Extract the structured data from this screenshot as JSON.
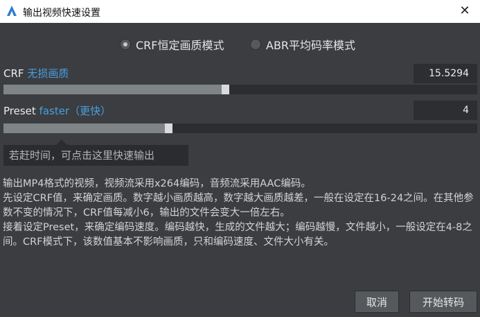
{
  "window": {
    "title": "输出视频快速设置",
    "close_glyph": "✕"
  },
  "modes": [
    {
      "label": "CRF恒定画质模式",
      "checked": true
    },
    {
      "label": "ABR平均码率模式",
      "checked": false
    }
  ],
  "crf": {
    "label": "CRF",
    "quality_text": "无损画质",
    "value": "15.5294",
    "level": 0.46
  },
  "preset": {
    "label": "Preset",
    "speed_text": "faster（更快）",
    "value": "4",
    "level": 0.34
  },
  "tooltip": "若赶时间，可点击这里快速输出",
  "description": [
    "输出MP4格式的视频，视频流采用x264编码，音频流采用AAC编码。",
    "先设定CRF值，来确定画质。数字越小画质越高，数字越大画质越差，一般在设定在16-24之间。在其他参数不变的情况下，CRF值每减小6，输出的文件会变大一倍左右。",
    "接着设定Preset，来确定编码速度。编码越快，生成的文件越大；编码越慢，文件越小，一般设定在4-8之间。CRF模式下，该数值基本不影响画质，只和编码速度、文件大小有关。"
  ],
  "buttons": {
    "cancel": "取消",
    "start": "开始转码"
  },
  "colors": {
    "accent": "#4a9fe0",
    "background": "#3b3d41"
  }
}
